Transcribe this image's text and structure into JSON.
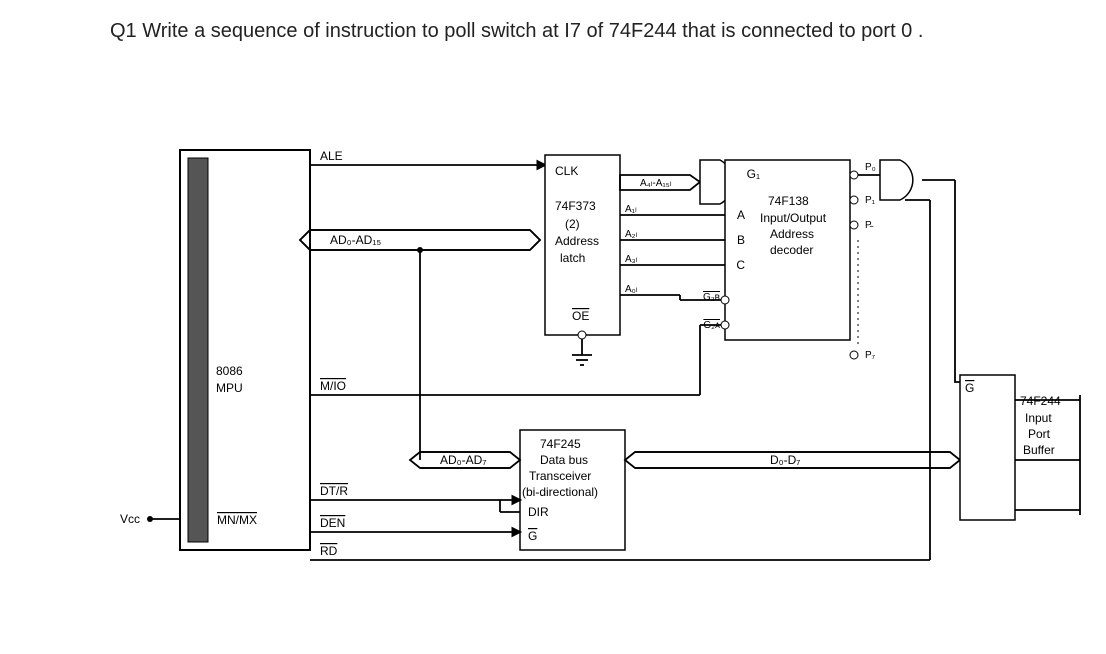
{
  "question": "Q1 Write a sequence of instruction to poll switch at  I7 of 74F244 that is connected to port 0 .",
  "mpu": {
    "line1": "8086",
    "line2": "MPU"
  },
  "mpu_signals": {
    "ale": "ALE",
    "ad_bus_hi": "AD₀-AD₁₅",
    "mio": "M/IO",
    "dtr": "DT/R",
    "den": "DEN",
    "rd": "RD",
    "mnmx": "MN/MX",
    "vcc": "Vcc"
  },
  "latch": {
    "clk": "CLK",
    "name": "74F373",
    "qty": "(2)",
    "desc1": "Address",
    "desc2": "latch",
    "oe": "OE",
    "a_hi": "A₄ₗ-A₁₅ₗ",
    "a1": "A₁ₗ",
    "a2": "A₂ₗ",
    "a3": "A₃ₗ",
    "a0": "A₀ₗ"
  },
  "decoder": {
    "name": "74F138",
    "desc1": "Input/Output",
    "desc2": "Address",
    "desc3": "decoder",
    "g1": "G₁",
    "a": "A",
    "b": "B",
    "c": "C",
    "g2b": "G₂ʙ",
    "g2a": "G₂ᴀ",
    "p0": "P₀",
    "p1": "P₁",
    "px": "P̵",
    "p7": "P₇"
  },
  "transceiver": {
    "ad_lo": "AD₀-AD₇",
    "name": "74F245",
    "desc1": "Data bus",
    "desc2": "Transceiver",
    "desc3": "(bi-directional)",
    "dir": "DIR",
    "g": "G",
    "d_bus": "D₀-D₇"
  },
  "buffer": {
    "g": "G",
    "name": "74F244",
    "desc1": "Input",
    "desc2": "Port",
    "desc3": "Buffer"
  }
}
